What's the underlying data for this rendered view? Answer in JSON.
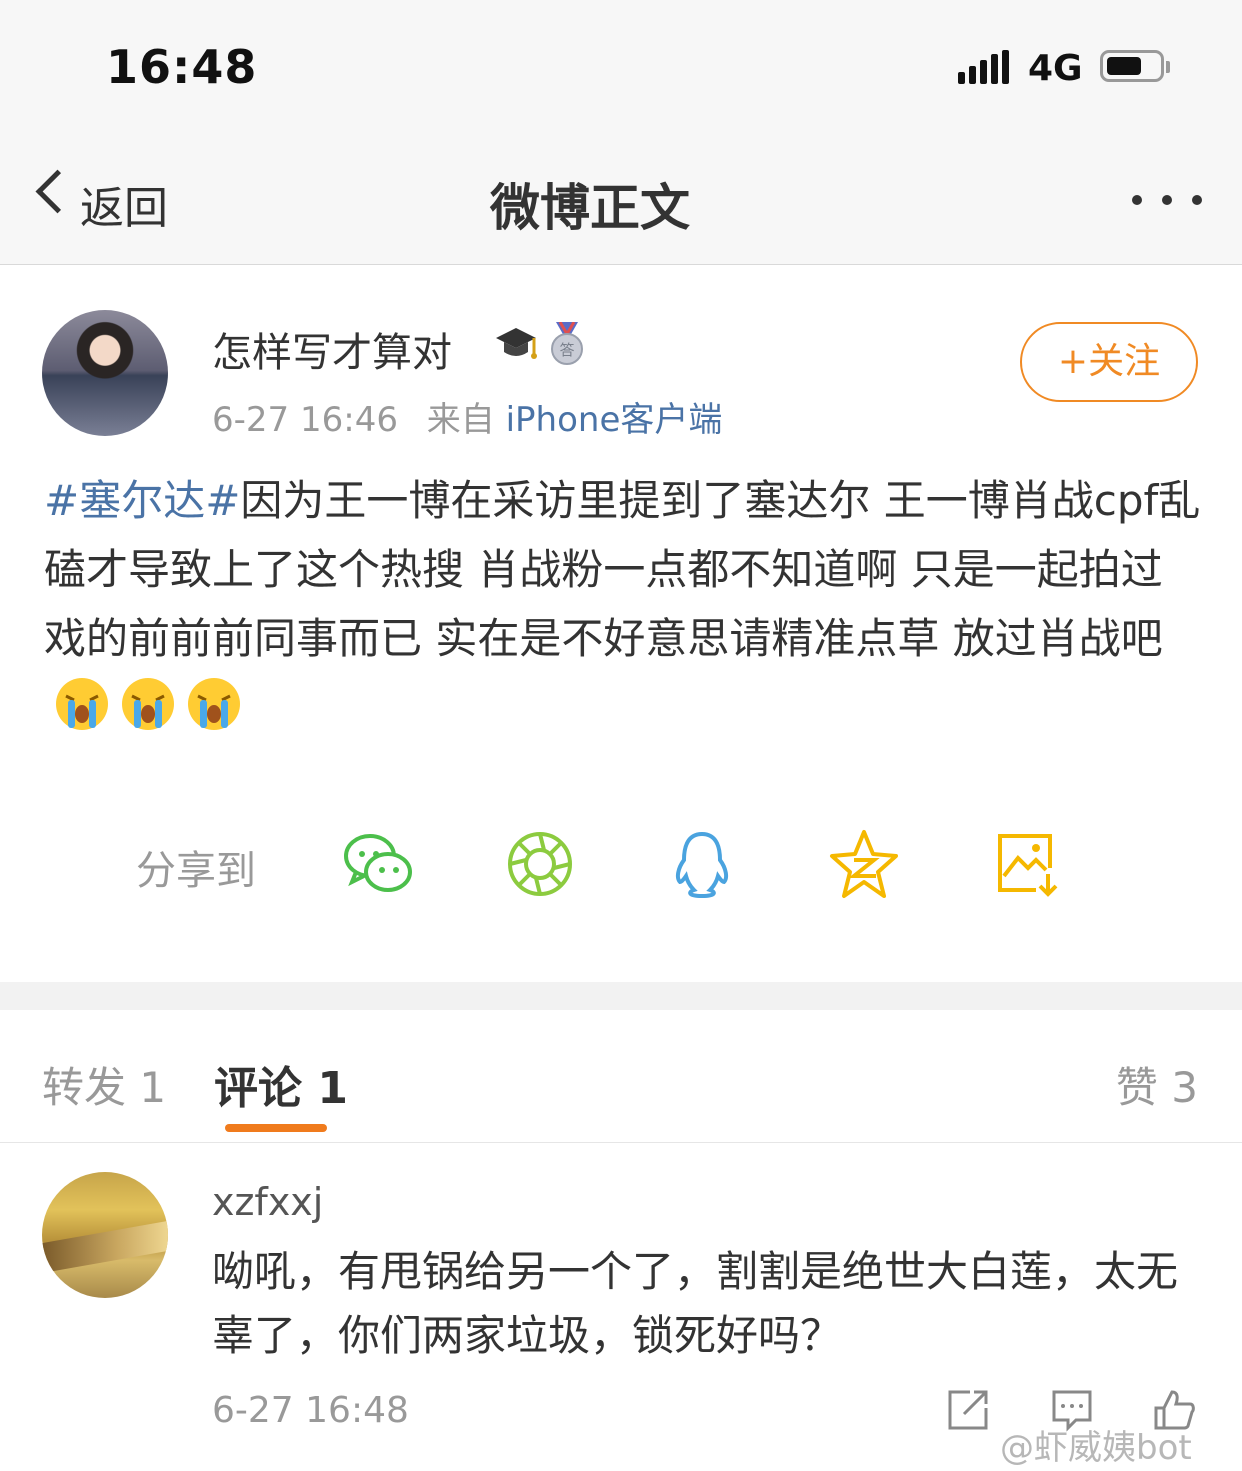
{
  "status_bar": {
    "time": "16:48",
    "network": "4G"
  },
  "nav": {
    "back_label": "返回",
    "title": "微博正文"
  },
  "post": {
    "username": "怎样写才算对",
    "time": "6-27 16:46",
    "source_prefix": "来自",
    "source": "iPhone客户端",
    "follow_label": "+关注",
    "hashtag": "#塞尔达#",
    "text": "因为王一博在采访里提到了塞达尔 王一博肖战cpf乱磕才导致上了这个热搜 肖战粉一点都不知道啊 只是一起拍过戏的前前前同事而已 实在是不好意思请精准点草 放过肖战吧"
  },
  "share": {
    "label": "分享到",
    "icons": [
      "wechat-icon",
      "moments-icon",
      "qq-icon",
      "qzone-icon",
      "save-image-icon"
    ]
  },
  "tabs": {
    "repost": "转发 1",
    "comment": "评论 1",
    "like": "赞 3"
  },
  "comment": {
    "username": "xzfxxj",
    "text": "呦吼，有甩锅给另一个了，割割是绝世大白莲，太无辜了，你们两家垃圾，锁死好吗？",
    "time": "6-27 16:48"
  },
  "watermark": "@虾威姨bot",
  "colors": {
    "link": "#4a73a6",
    "accent": "#f08a24",
    "wechat": "#4cbf4b",
    "moments": "#8ccb3f",
    "qq": "#4aa3df",
    "qzone": "#f5b800"
  }
}
